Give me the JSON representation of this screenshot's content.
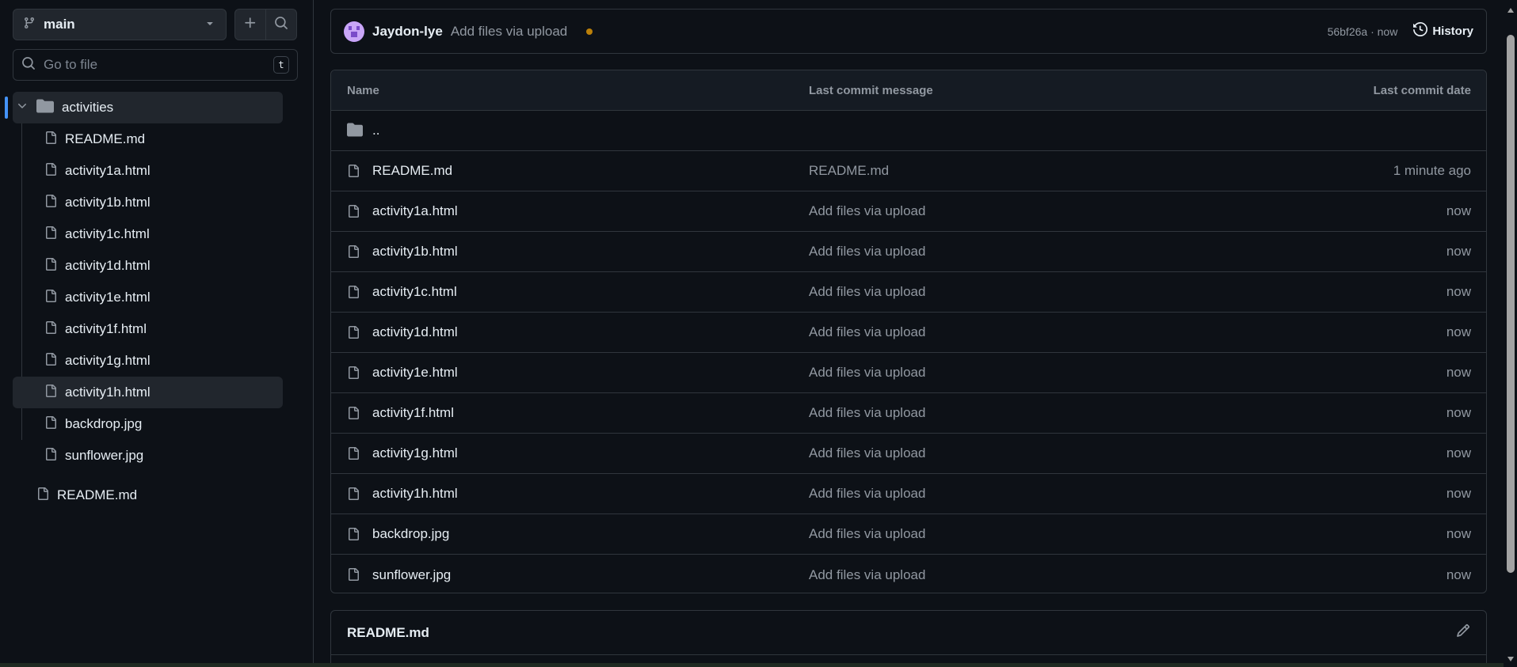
{
  "sidebar": {
    "branch": {
      "label": "main",
      "icon": "git-branch-icon"
    },
    "add_button_icon": "plus-icon",
    "search_button_icon": "search-icon",
    "goto": {
      "placeholder": "Go to file",
      "shortcut": "t"
    },
    "folder": {
      "label": "activities",
      "expanded": true
    },
    "folder_items": [
      {
        "label": "README.md",
        "selected": false
      },
      {
        "label": "activity1a.html",
        "selected": false
      },
      {
        "label": "activity1b.html",
        "selected": false
      },
      {
        "label": "activity1c.html",
        "selected": false
      },
      {
        "label": "activity1d.html",
        "selected": false
      },
      {
        "label": "activity1e.html",
        "selected": false
      },
      {
        "label": "activity1f.html",
        "selected": false
      },
      {
        "label": "activity1g.html",
        "selected": false
      },
      {
        "label": "activity1h.html",
        "selected": true
      },
      {
        "label": "backdrop.jpg",
        "selected": false
      },
      {
        "label": "sunflower.jpg",
        "selected": false
      }
    ],
    "root_items": [
      {
        "label": "README.md"
      }
    ]
  },
  "commit": {
    "author": "Jaydon-lye",
    "message": "Add files via upload",
    "status_color": "#bb8009",
    "meta": "56bf26a · now",
    "history_label": "History"
  },
  "table": {
    "headers": {
      "name": "Name",
      "message": "Last commit message",
      "date": "Last commit date"
    },
    "parent_row": "..",
    "rows": [
      {
        "name": "README.md",
        "message": "README.md",
        "date": "1 minute ago"
      },
      {
        "name": "activity1a.html",
        "message": "Add files via upload",
        "date": "now"
      },
      {
        "name": "activity1b.html",
        "message": "Add files via upload",
        "date": "now"
      },
      {
        "name": "activity1c.html",
        "message": "Add files via upload",
        "date": "now"
      },
      {
        "name": "activity1d.html",
        "message": "Add files via upload",
        "date": "now"
      },
      {
        "name": "activity1e.html",
        "message": "Add files via upload",
        "date": "now"
      },
      {
        "name": "activity1f.html",
        "message": "Add files via upload",
        "date": "now"
      },
      {
        "name": "activity1g.html",
        "message": "Add files via upload",
        "date": "now"
      },
      {
        "name": "activity1h.html",
        "message": "Add files via upload",
        "date": "now"
      },
      {
        "name": "backdrop.jpg",
        "message": "Add files via upload",
        "date": "now"
      },
      {
        "name": "sunflower.jpg",
        "message": "Add files via upload",
        "date": "now"
      }
    ]
  },
  "readme": {
    "title": "README.md",
    "edit_icon": "pencil-icon"
  },
  "colors": {
    "background": "#0d1117",
    "border": "#30363d",
    "accent": "#4493f8",
    "muted_text": "#9198a1"
  }
}
